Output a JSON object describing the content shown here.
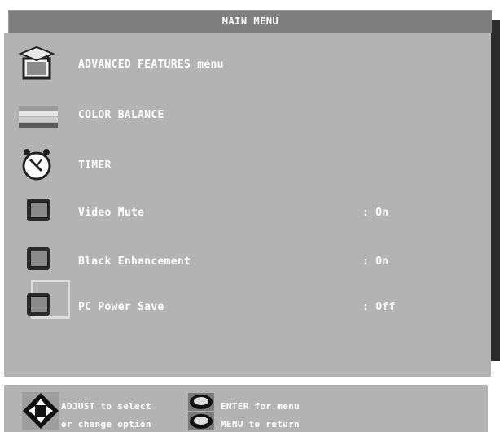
{
  "title": "MAIN MENU",
  "items": [
    {
      "label": "ADVANCED FEATURES menu",
      "value": "",
      "icon": "graduation-cap-icon"
    },
    {
      "label": "COLOR BALANCE",
      "value": "",
      "icon": "color-bars-icon"
    },
    {
      "label": "TIMER",
      "value": "",
      "icon": "alarm-clock-icon"
    },
    {
      "label": "Video Mute",
      "value": ": On",
      "icon": "toggle-button-icon"
    },
    {
      "label": "Black Enhancement",
      "value": ": On",
      "icon": "toggle-button-icon"
    },
    {
      "label": "PC Power Save",
      "value": ": Off",
      "icon": "toggle-button-icon",
      "selected": true
    }
  ],
  "footer": {
    "adjust_line1": "ADJUST to select",
    "adjust_line2": "or change option",
    "enter_text": "ENTER for menu",
    "menu_text": "MENU to return"
  },
  "colors": {
    "panel": "#b3b3b3",
    "title_bar": "#7f7f7f",
    "shadow": "#2b2b2b",
    "text": "#ffffff"
  }
}
